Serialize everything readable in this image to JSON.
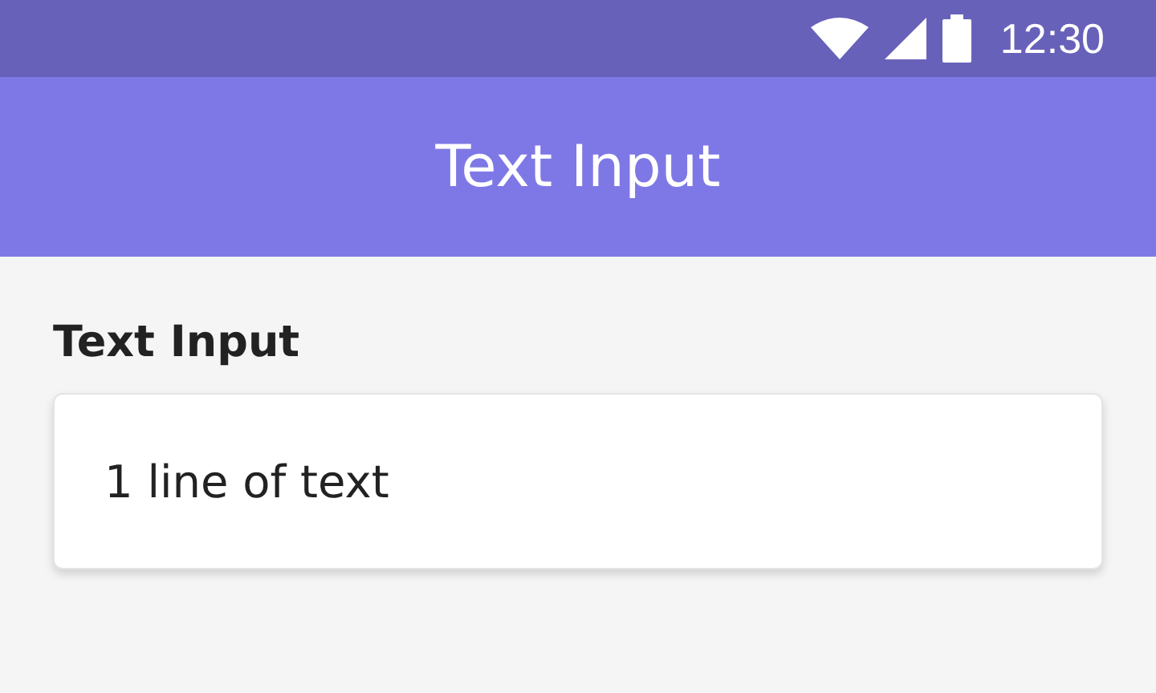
{
  "status_bar": {
    "time": "12:30"
  },
  "app_bar": {
    "title": "Text Input"
  },
  "field": {
    "label": "Text Input",
    "value": "1 line of text"
  }
}
